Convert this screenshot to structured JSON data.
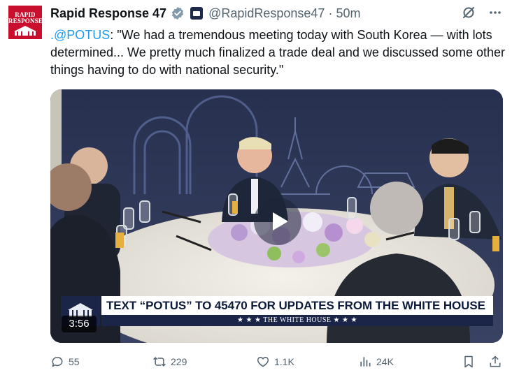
{
  "account": {
    "avatar_line1": "RAPID",
    "avatar_line2": "RESPONSE",
    "display_name": "Rapid Response 47",
    "handle": "@RapidResponse47",
    "separator": "·",
    "time": "50m"
  },
  "tweet": {
    "mention": ".@POTUS",
    "body": ": \"We had a tremendous meeting today with South Korea — with lots determined... We pretty much finalized a trade deal and we discussed some other things having to do with national security.\""
  },
  "video": {
    "duration": "3:56",
    "lower_third_text": "TEXT “POTUS” TO 45470 FOR UPDATES FROM THE WHITE HOUSE",
    "lower_third_sub": "★ ★ ★   THE WHITE HOUSE   ★ ★ ★"
  },
  "actions": {
    "replies": "55",
    "reposts": "229",
    "likes": "1.1K",
    "views": "24K"
  },
  "colors": {
    "accent": "#1d9bf0",
    "verified": "#829aab",
    "muted": "#536471"
  },
  "icons": [
    "grok-icon",
    "more-icon",
    "verified-badge-icon",
    "government-flag-icon",
    "play-icon",
    "reply-icon",
    "repost-icon",
    "like-icon",
    "views-icon",
    "bookmark-icon",
    "share-icon"
  ]
}
